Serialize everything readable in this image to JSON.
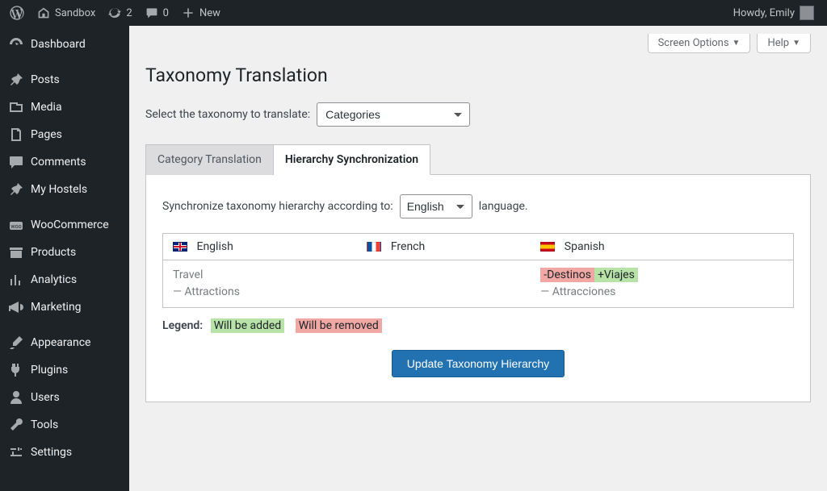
{
  "adminbar": {
    "site_name": "Sandbox",
    "updates_count": "2",
    "comments_count": "0",
    "new_label": "New",
    "howdy": "Howdy, Emily"
  },
  "sidebar": {
    "items": [
      {
        "label": "Dashboard",
        "icon": "dashboard"
      },
      {
        "label": "Posts",
        "icon": "pin"
      },
      {
        "label": "Media",
        "icon": "media"
      },
      {
        "label": "Pages",
        "icon": "pages"
      },
      {
        "label": "Comments",
        "icon": "comment"
      },
      {
        "label": "My Hostels",
        "icon": "pin"
      },
      {
        "label": "WooCommerce",
        "icon": "woo"
      },
      {
        "label": "Products",
        "icon": "archive"
      },
      {
        "label": "Analytics",
        "icon": "chart"
      },
      {
        "label": "Marketing",
        "icon": "megaphone"
      },
      {
        "label": "Appearance",
        "icon": "brush"
      },
      {
        "label": "Plugins",
        "icon": "plug"
      },
      {
        "label": "Users",
        "icon": "user"
      },
      {
        "label": "Tools",
        "icon": "wrench"
      },
      {
        "label": "Settings",
        "icon": "sliders"
      }
    ],
    "separators_after": [
      0,
      5,
      9
    ]
  },
  "top_buttons": {
    "screen_options": "Screen Options",
    "help": "Help"
  },
  "page": {
    "title": "Taxonomy Translation",
    "select_label": "Select the taxonomy to translate:",
    "taxonomy_selected": "Categories"
  },
  "tabs": {
    "category_translation": "Category Translation",
    "hierarchy_sync": "Hierarchy Synchronization",
    "active": "hierarchy_sync"
  },
  "sync": {
    "pre": "Synchronize taxonomy hierarchy according to:",
    "lang_selected": "English",
    "post": "language."
  },
  "lang_table": {
    "headers": [
      {
        "flag": "en",
        "label": "English"
      },
      {
        "flag": "fr",
        "label": "French"
      },
      {
        "flag": "es",
        "label": "Spanish"
      }
    ],
    "rows": [
      {
        "en": [
          "Travel",
          "— Attractions"
        ],
        "fr": [],
        "es_diff": {
          "remove": "-Destinos",
          "add": "+Viajes"
        },
        "es_rest": [
          "— Attracciones"
        ]
      }
    ]
  },
  "legend": {
    "label": "Legend:",
    "added": "Will be added",
    "removed": "Will be removed"
  },
  "buttons": {
    "update": "Update Taxonomy Hierarchy"
  }
}
